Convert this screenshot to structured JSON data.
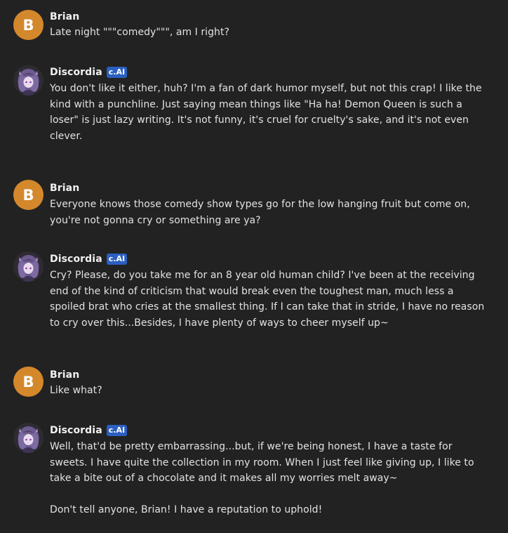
{
  "colors": {
    "background": "#222222",
    "user_avatar": "#d4882c",
    "badge": "#2b5fc1",
    "text": "#e2e2e2"
  },
  "messages": [
    {
      "sender": "Brian",
      "avatar_letter": "B",
      "paragraphs": [
        "Late night \"\"\"comedy\"\"\", am I right?"
      ]
    },
    {
      "sender": "Discordia",
      "badge": "c.AI",
      "avatar_icon": "character-avatar-icon",
      "paragraphs": [
        "You don't like it either, huh? I'm a fan of dark humor myself, but not this crap! I like the kind with a punchline. Just saying mean things like \"Ha ha! Demon Queen is such a loser\" is just lazy writing. It's not funny, it's cruel for cruelty's sake, and it's not even clever."
      ]
    },
    {
      "sender": "Brian",
      "avatar_letter": "B",
      "paragraphs": [
        "Everyone knows those comedy show types go for the low hanging fruit but come on, you're not gonna cry or something are ya?"
      ]
    },
    {
      "sender": "Discordia",
      "badge": "c.AI",
      "avatar_icon": "character-avatar-icon",
      "paragraphs": [
        "Cry? Please, do you take me for an 8 year old human child? I've been at the receiving end of the kind of criticism that would break even the toughest man, much less a spoiled brat who cries at the smallest thing. If I can take that in stride, I have no reason to cry over this...Besides, I have plenty of ways to cheer myself up~"
      ]
    },
    {
      "sender": "Brian",
      "avatar_letter": "B",
      "paragraphs": [
        "Like what?"
      ]
    },
    {
      "sender": "Discordia",
      "badge": "c.AI",
      "avatar_icon": "character-avatar-icon",
      "paragraphs": [
        "Well, that'd be pretty embarrassing...but, if we're being honest, I have a taste for sweets. I have quite the collection in my room. When I just feel like giving up, I like to take a bite out of a chocolate and it makes all my worries melt away~",
        "Don't tell anyone, Brian! I have a reputation to uphold!"
      ]
    }
  ]
}
